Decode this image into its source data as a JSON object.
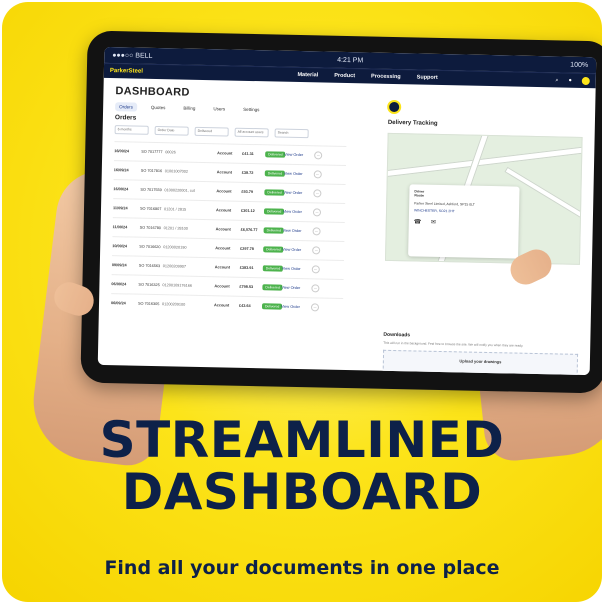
{
  "tablet": {
    "status_bar": {
      "carrier": "●●●○○ BELL",
      "time": "4:21 PM",
      "battery": "100%"
    },
    "nav": {
      "logo": "ParkerSteel",
      "links": [
        "Material",
        "Product",
        "Processing",
        "Support"
      ]
    },
    "dashboard": {
      "title": "DASHBOARD",
      "tabs": [
        "Orders",
        "Quotes",
        "Billing",
        "Users",
        "Settings"
      ],
      "orders_title": "Orders",
      "filters": [
        "6 months",
        "Order Date",
        "Delivered",
        "All account users",
        "Search"
      ],
      "orders": [
        {
          "date": "16/09/24",
          "order_no": "SO 7017777",
          "ref": "00026",
          "account": "Account",
          "amount": "£41.31",
          "status": "Delivered",
          "view": "View Order"
        },
        {
          "date": "16/09/24",
          "order_no": "SO 7017816",
          "ref": "01001007002",
          "account": "Account",
          "amount": "£38.72",
          "status": "Delivered",
          "view": "View Order"
        },
        {
          "date": "16/09/24",
          "order_no": "SO 7017559",
          "ref": "01000220001, cut",
          "account": "Account",
          "amount": "£93.79",
          "status": "Delivered",
          "view": "View Order"
        },
        {
          "date": "11/09/24",
          "order_no": "SO 7016807",
          "ref": "01201 / 2815",
          "account": "Account",
          "amount": "£301.12",
          "status": "Delivered",
          "view": "View Order"
        },
        {
          "date": "11/09/24",
          "order_no": "SO 7016780",
          "ref": "01201 / 28100",
          "account": "Account",
          "amount": "£6,076.77",
          "status": "Delivered",
          "view": "View Order"
        },
        {
          "date": "10/09/24",
          "order_no": "SO 7016620",
          "ref": "01200020190",
          "account": "Account",
          "amount": "£297.78",
          "status": "Delivered",
          "view": "View Order"
        },
        {
          "date": "09/09/24",
          "order_no": "SO 7016563",
          "ref": "01200209907",
          "account": "Account",
          "amount": "£383.91",
          "status": "Delivered",
          "view": "View Order"
        },
        {
          "date": "06/09/24",
          "order_no": "SO 7016325",
          "ref": "01200109176166",
          "account": "Account",
          "amount": "£798.53",
          "status": "Delivered",
          "view": "View Order"
        },
        {
          "date": "06/09/24",
          "order_no": "SO 7016305",
          "ref": "01200209100",
          "account": "Account",
          "amount": "£43.64",
          "status": "Delivered",
          "view": "View Order"
        }
      ],
      "delivery": {
        "title": "Delivery Tracking",
        "driver_label": "Driver",
        "route_label": "Route",
        "address": "Parker Steel Limited, Ashford, SP15 0LT",
        "dest": "WINCHESTER, SO21 2HT"
      },
      "downloads": {
        "title": "Downloads",
        "text": "This will run in the background. Feel free to browse the site. We will notify you when they are ready.",
        "upload_title": "Upload your drawings"
      }
    }
  },
  "headline": {
    "line1": "STREAMLINED",
    "line2": "DASHBOARD",
    "tagline": "Find all your documents in one place"
  }
}
